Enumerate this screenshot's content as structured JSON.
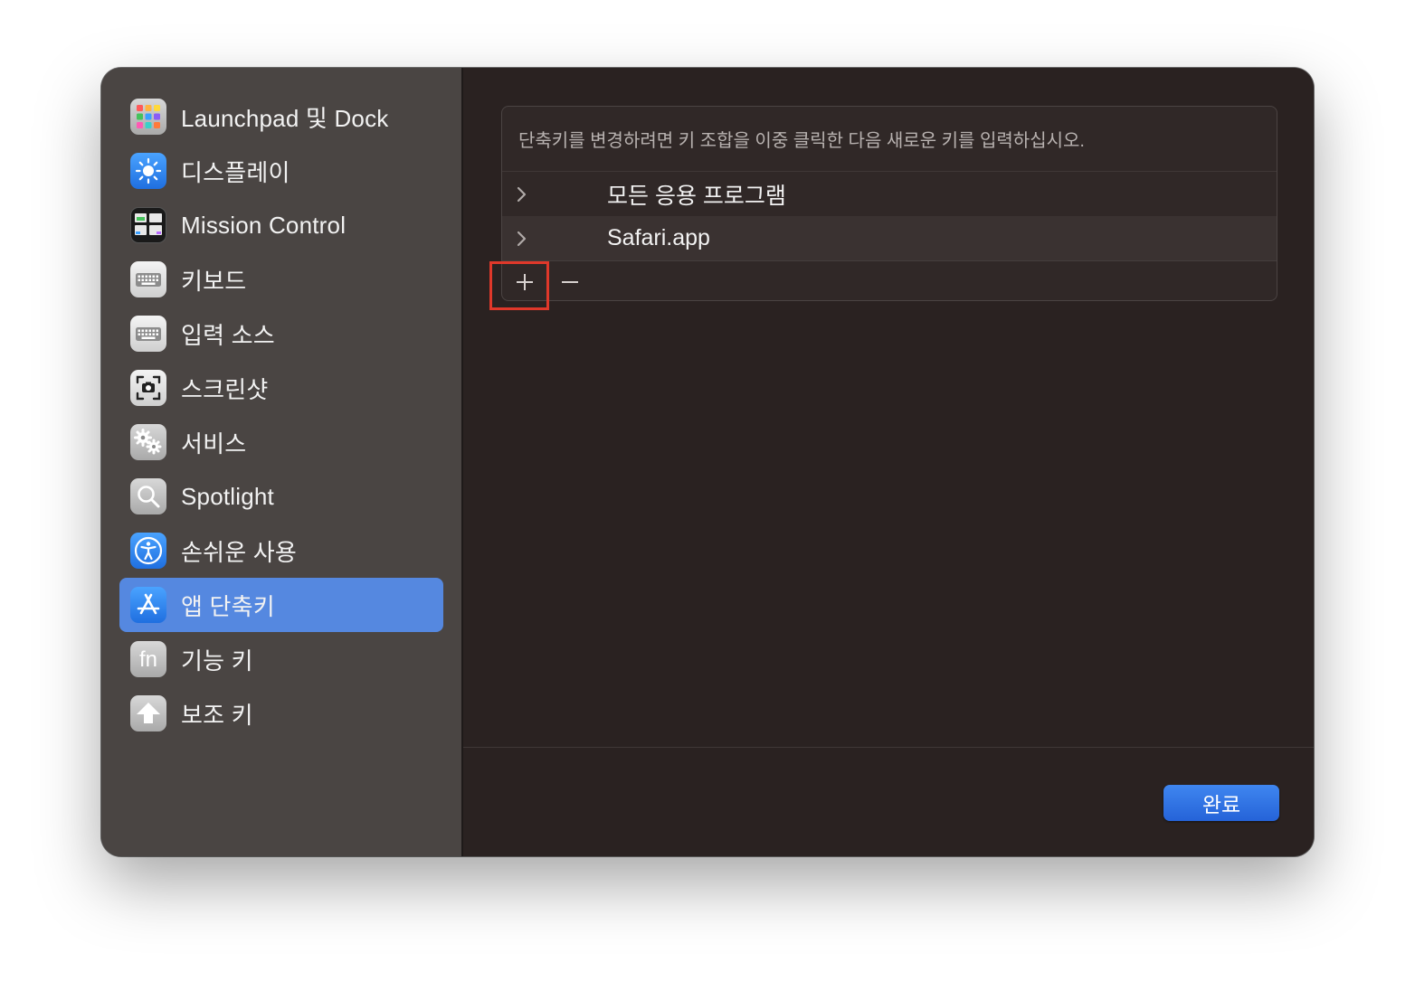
{
  "sidebar": {
    "items": [
      {
        "label": "Launchpad 및 Dock",
        "icon": "launchpad-icon"
      },
      {
        "label": "디스플레이",
        "icon": "display-brightness-icon"
      },
      {
        "label": "Mission Control",
        "icon": "mission-control-icon"
      },
      {
        "label": "키보드",
        "icon": "keyboard-icon"
      },
      {
        "label": "입력 소스",
        "icon": "keyboard-icon"
      },
      {
        "label": "스크린샷",
        "icon": "screenshot-camera-icon"
      },
      {
        "label": "서비스",
        "icon": "gears-icon"
      },
      {
        "label": "Spotlight",
        "icon": "magnifier-icon"
      },
      {
        "label": "손쉬운 사용",
        "icon": "accessibility-icon"
      },
      {
        "label": "앱 단축키",
        "icon": "app-store-icon",
        "selected": true
      },
      {
        "label": "기능 키",
        "icon": "fn-key-icon"
      },
      {
        "label": "보조 키",
        "icon": "modifier-arrow-up-icon"
      }
    ]
  },
  "main": {
    "hint": "단축키를 변경하려면 키 조합을 이중 클릭한 다음 새로운 키를 입력하십시오.",
    "rows": [
      {
        "label": "모든 응용 프로그램"
      },
      {
        "label": "Safari.app"
      }
    ],
    "add_label": "+",
    "remove_label": "−",
    "done_label": "완료"
  },
  "colors": {
    "sidebar_bg": "#4a4543",
    "content_bg": "#2a2221",
    "selection": "#5588e0",
    "accent_button": "#2f6fe4",
    "highlight_box": "#e0382a"
  }
}
